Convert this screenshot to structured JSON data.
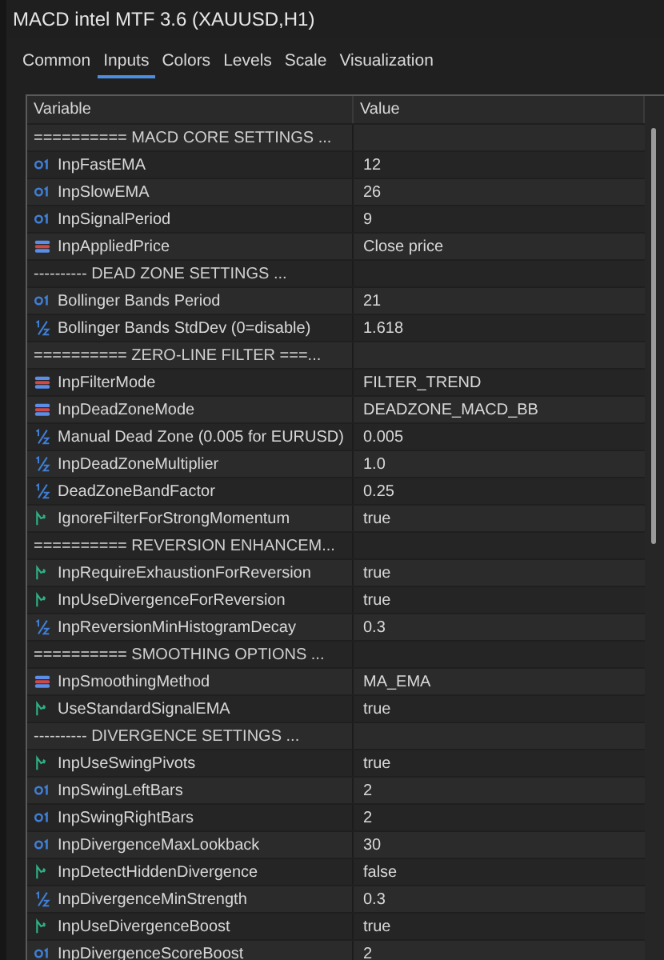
{
  "window": {
    "title": "MACD intel MTF 3.6 (XAUUSD,H1)"
  },
  "tabs": [
    {
      "label": "Common",
      "selected": false
    },
    {
      "label": "Inputs",
      "selected": true
    },
    {
      "label": "Colors",
      "selected": false
    },
    {
      "label": "Levels",
      "selected": false
    },
    {
      "label": "Scale",
      "selected": false
    },
    {
      "label": "Visualization",
      "selected": false
    }
  ],
  "table": {
    "columns": [
      "Variable",
      "Value"
    ],
    "rows": [
      {
        "kind": "section",
        "variable": "========== MACD CORE SETTINGS ..."
      },
      {
        "kind": "int",
        "variable": "InpFastEMA",
        "value": "12"
      },
      {
        "kind": "int",
        "variable": "InpSlowEMA",
        "value": "26"
      },
      {
        "kind": "int",
        "variable": "InpSignalPeriod",
        "value": "9"
      },
      {
        "kind": "enum",
        "variable": "InpAppliedPrice",
        "value": "Close price"
      },
      {
        "kind": "section",
        "variable": "---------- DEAD ZONE SETTINGS ..."
      },
      {
        "kind": "int",
        "variable": "Bollinger Bands Period",
        "value": "21"
      },
      {
        "kind": "double",
        "variable": "Bollinger Bands StdDev (0=disable)",
        "value": "1.618"
      },
      {
        "kind": "section",
        "variable": "========== ZERO-LINE FILTER ===..."
      },
      {
        "kind": "enum",
        "variable": "InpFilterMode",
        "value": "FILTER_TREND"
      },
      {
        "kind": "enum",
        "variable": "InpDeadZoneMode",
        "value": "DEADZONE_MACD_BB"
      },
      {
        "kind": "double",
        "variable": "Manual Dead Zone (0.005 for EURUSD)",
        "value": "0.005"
      },
      {
        "kind": "double",
        "variable": "InpDeadZoneMultiplier",
        "value": "1.0"
      },
      {
        "kind": "double",
        "variable": "DeadZoneBandFactor",
        "value": "0.25"
      },
      {
        "kind": "bool",
        "variable": "IgnoreFilterForStrongMomentum",
        "value": "true"
      },
      {
        "kind": "section",
        "variable": "========== REVERSION ENHANCEM..."
      },
      {
        "kind": "bool",
        "variable": "InpRequireExhaustionForReversion",
        "value": "true"
      },
      {
        "kind": "bool",
        "variable": "InpUseDivergenceForReversion",
        "value": "true"
      },
      {
        "kind": "double",
        "variable": "InpReversionMinHistogramDecay",
        "value": "0.3"
      },
      {
        "kind": "section",
        "variable": "========== SMOOTHING OPTIONS ..."
      },
      {
        "kind": "enum",
        "variable": "InpSmoothingMethod",
        "value": "MA_EMA"
      },
      {
        "kind": "bool",
        "variable": "UseStandardSignalEMA",
        "value": "true"
      },
      {
        "kind": "section",
        "variable": "---------- DIVERGENCE SETTINGS ..."
      },
      {
        "kind": "bool",
        "variable": "InpUseSwingPivots",
        "value": "true"
      },
      {
        "kind": "int",
        "variable": "InpSwingLeftBars",
        "value": "2"
      },
      {
        "kind": "int",
        "variable": "InpSwingRightBars",
        "value": "2"
      },
      {
        "kind": "int",
        "variable": "InpDivergenceMaxLookback",
        "value": "30"
      },
      {
        "kind": "bool",
        "variable": "InpDetectHiddenDivergence",
        "value": "false"
      },
      {
        "kind": "double",
        "variable": "InpDivergenceMinStrength",
        "value": "0.3"
      },
      {
        "kind": "bool",
        "variable": "InpUseDivergenceBoost",
        "value": "true"
      },
      {
        "kind": "int",
        "variable": "InpDivergenceScoreBoost",
        "value": "2"
      }
    ]
  }
}
